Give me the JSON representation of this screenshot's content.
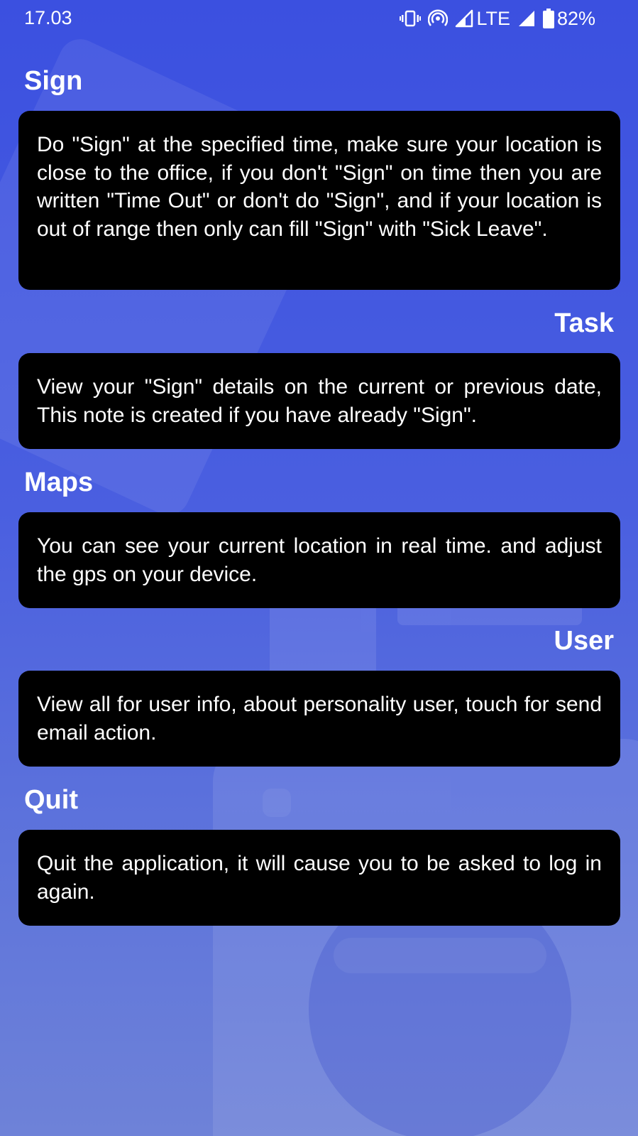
{
  "status_bar": {
    "time": "17.03",
    "network": "LTE",
    "battery": "82%",
    "icons": [
      "vibrate-icon",
      "hotspot-icon",
      "signal-icon",
      "signal-icon",
      "battery-icon"
    ]
  },
  "sections": [
    {
      "title": "Sign",
      "body": "Do \"Sign\" at the specified time, make sure your location is close to the office, if you don't \"Sign\" on time then you are written \"Time Out\" or don't do \"Sign\", and if your location is out of range then only can fill \"Sign\" with \"Sick Leave\"."
    },
    {
      "title": "Task",
      "body": "View your \"Sign\" details on the current or previous date, This note is created if you have already \"Sign\"."
    },
    {
      "title": "Maps",
      "body": "You can see your current location in real time. and adjust the gps on your device."
    },
    {
      "title": "User",
      "body": "View all for user info, about personality user, touch for send email action."
    },
    {
      "title": "Quit",
      "body": "Quit the application, it will cause you to be asked to log in again."
    }
  ],
  "colors": {
    "background_top": "#3b50e0",
    "background_bottom": "#6e82d8",
    "card": "#000000",
    "text": "#ffffff"
  }
}
